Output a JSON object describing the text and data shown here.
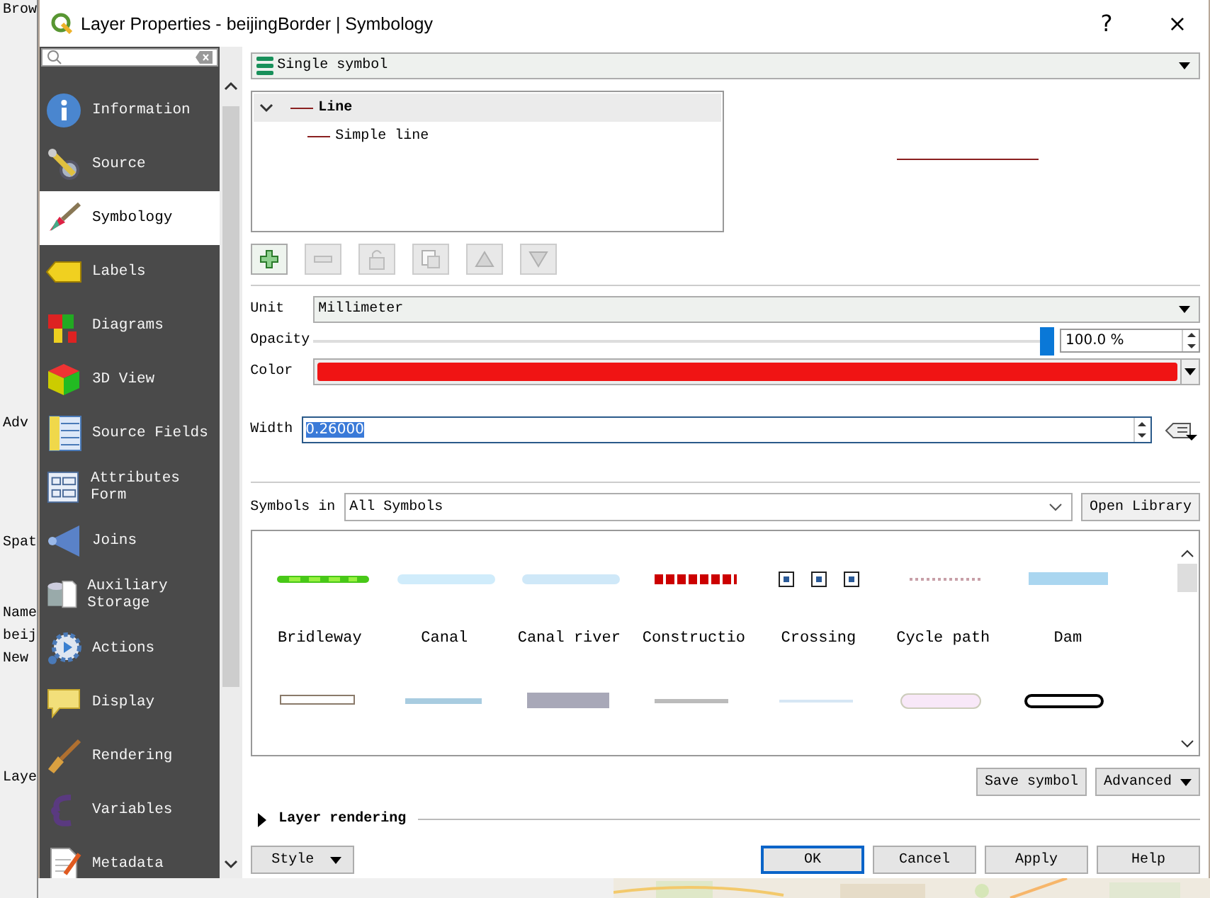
{
  "background_window": {
    "labels": [
      "Brow",
      "Adv",
      "Spat",
      "Name",
      "beij",
      "New",
      "Laye"
    ]
  },
  "window": {
    "title": "Layer Properties - beijingBorder | Symbology",
    "help": "?",
    "close": "×"
  },
  "sidebar": {
    "items": [
      {
        "label": "Information",
        "selected": false
      },
      {
        "label": "Source",
        "selected": false
      },
      {
        "label": "Symbology",
        "selected": true
      },
      {
        "label": "Labels",
        "selected": false
      },
      {
        "label": "Diagrams",
        "selected": false
      },
      {
        "label": "3D View",
        "selected": false
      },
      {
        "label": "Source Fields",
        "selected": false
      },
      {
        "label": "Attributes Form",
        "selected": false
      },
      {
        "label": "Joins",
        "selected": false
      },
      {
        "label": "Auxiliary Storage",
        "selected": false
      },
      {
        "label": "Actions",
        "selected": false
      },
      {
        "label": "Display",
        "selected": false
      },
      {
        "label": "Rendering",
        "selected": false
      },
      {
        "label": "Variables",
        "selected": false
      },
      {
        "label": "Metadata",
        "selected": false
      }
    ]
  },
  "renderer": {
    "value": "Single symbol"
  },
  "symbol_tree": {
    "items": [
      {
        "label": "Line",
        "selected": true,
        "expanded": true,
        "children": [
          {
            "label": "Simple line",
            "selected": false
          }
        ]
      }
    ]
  },
  "layer_buttons": [
    {
      "kind": "add",
      "disabled": false
    },
    {
      "kind": "remove",
      "disabled": true
    },
    {
      "kind": "lock",
      "disabled": true
    },
    {
      "kind": "duplicate",
      "disabled": true
    },
    {
      "kind": "up",
      "disabled": true
    },
    {
      "kind": "down",
      "disabled": true
    }
  ],
  "properties": {
    "unit": {
      "label": "Unit",
      "value": "Millimeter"
    },
    "opacity": {
      "label": "Opacity",
      "level": 1.0,
      "reading": "100.0 %"
    },
    "color": {
      "label": "Color",
      "color": "#f01414"
    },
    "width": {
      "label": "Width",
      "value": "0.26000",
      "selected": true
    }
  },
  "library": {
    "label": "Symbols in",
    "filter": "All Symbols",
    "open_button": "Open Library",
    "symbols": [
      {
        "kind": "line",
        "name": "Bridleway"
      },
      {
        "kind": "line",
        "name": "Canal"
      },
      {
        "kind": "line",
        "name": "Canal river"
      },
      {
        "kind": "line",
        "name": "Constructio"
      },
      {
        "kind": "line",
        "name": "Crossing"
      },
      {
        "kind": "line",
        "name": "Cycle path"
      },
      {
        "kind": "line",
        "name": "Dam"
      },
      {
        "kind": "line"
      },
      {
        "kind": "line"
      },
      {
        "kind": "line"
      },
      {
        "kind": "line"
      },
      {
        "kind": "line"
      },
      {
        "kind": "line"
      },
      {
        "kind": "line"
      }
    ]
  },
  "save_button": "Save symbol",
  "advanced_button": "Advanced",
  "layer_rendering": {
    "label": "Layer rendering",
    "expanded": false
  },
  "footer": {
    "style_button": "Style",
    "buttons": [
      {
        "label": "OK",
        "default": true
      },
      {
        "label": "Cancel",
        "default": false
      },
      {
        "label": "Apply",
        "default": false
      },
      {
        "label": "Help",
        "default": false
      }
    ]
  }
}
